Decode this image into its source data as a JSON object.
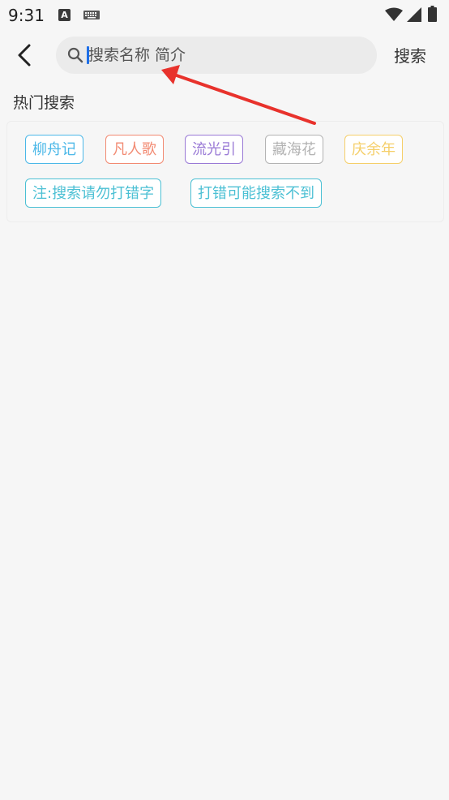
{
  "status_bar": {
    "time": "9:31",
    "notification_icon": "A"
  },
  "header": {
    "back_icon": "chevron-left-icon",
    "search_placeholder": "搜索名称 简介",
    "search_value": "",
    "search_button": "搜索"
  },
  "hot": {
    "title": "热门搜索",
    "tags": [
      {
        "label": "柳舟记",
        "color": "#4cb8e8"
      },
      {
        "label": "凡人歌",
        "color": "#f28a72"
      },
      {
        "label": "流光引",
        "color": "#9a7ad6"
      },
      {
        "label": "藏海花",
        "color": "#b3b3b3"
      },
      {
        "label": "庆余年",
        "color": "#f5cf6a"
      },
      {
        "label": "注:搜索请勿打错字",
        "color": "#4cc0d4"
      },
      {
        "label": "打错可能搜索不到",
        "color": "#4cc0d4"
      }
    ]
  },
  "annotation": {
    "arrow_color": "#e8322c"
  }
}
